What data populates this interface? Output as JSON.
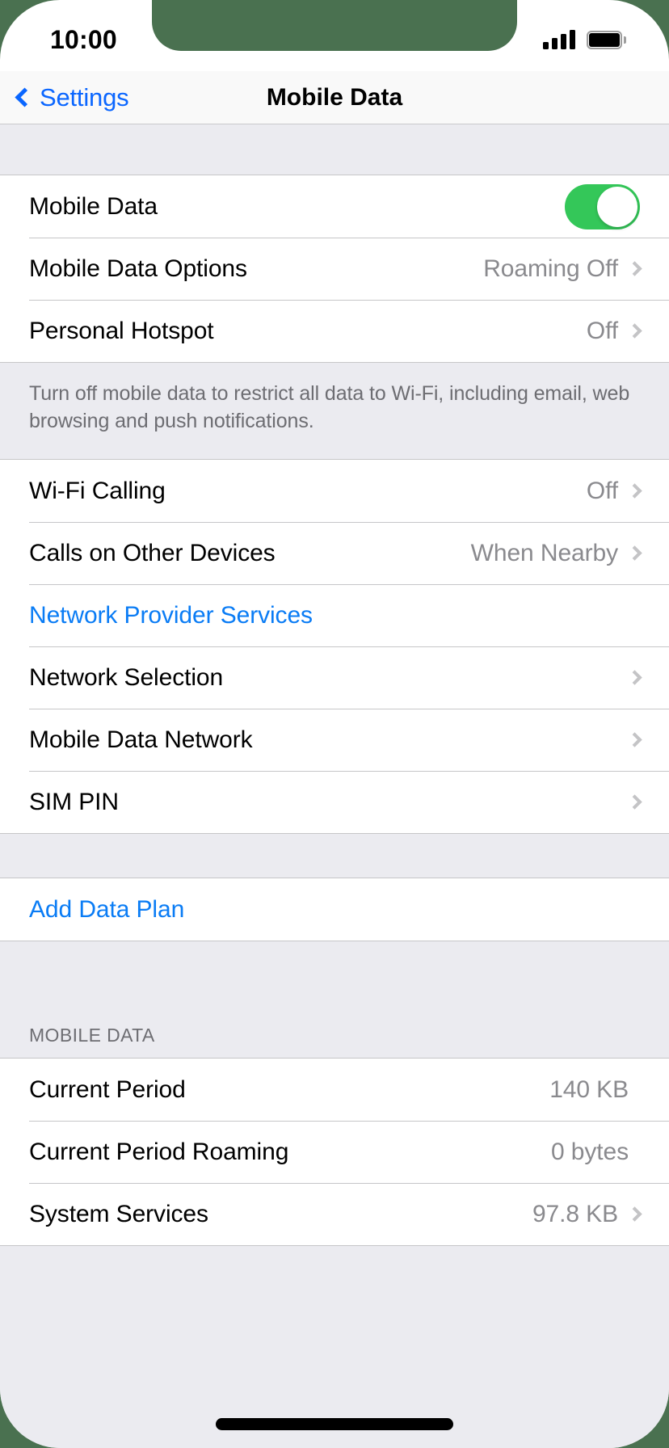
{
  "status_bar": {
    "time": "10:00",
    "signal_icon": "signal-bars-icon",
    "signal_bars_filled": 4,
    "battery_icon": "battery-full-icon"
  },
  "nav_bar": {
    "back_label": "Settings",
    "back_icon": "chevron-left-icon",
    "title": "Mobile Data"
  },
  "colors": {
    "accent_blue": "#0a7cf5",
    "back_blue": "#0a66ff",
    "toggle_green": "#34c759",
    "group_background": "#ffffff",
    "page_background": "#ebebf0",
    "separator": "#c6c6c8",
    "secondary_text": "#8a8a8e",
    "outside_background": "#4a7150"
  },
  "sections": [
    {
      "rows": [
        {
          "title": "Mobile Data",
          "control": "toggle",
          "toggle_on": true
        },
        {
          "title": "Mobile Data Options",
          "value": "Roaming Off",
          "chevron": true
        },
        {
          "title": "Personal Hotspot",
          "value": "Off",
          "chevron": true
        }
      ],
      "footer": "Turn off mobile data to restrict all data to Wi-Fi, including email, web browsing and push notifications."
    },
    {
      "rows": [
        {
          "title": "Wi-Fi Calling",
          "value": "Off",
          "chevron": true
        },
        {
          "title": "Calls on Other Devices",
          "value": "When Nearby",
          "chevron": true
        },
        {
          "title": "Network Provider Services",
          "link": true
        },
        {
          "title": "Network Selection",
          "chevron": true
        },
        {
          "title": "Mobile Data Network",
          "chevron": true
        },
        {
          "title": "SIM PIN",
          "chevron": true
        }
      ]
    },
    {
      "rows": [
        {
          "title": "Add Data Plan",
          "link": true
        }
      ]
    },
    {
      "header": "MOBILE DATA",
      "rows": [
        {
          "title": "Current Period",
          "value": "140 KB"
        },
        {
          "title": "Current Period Roaming",
          "value": "0 bytes"
        },
        {
          "title": "System Services",
          "value": "97.8 KB",
          "chevron": true
        }
      ]
    }
  ]
}
